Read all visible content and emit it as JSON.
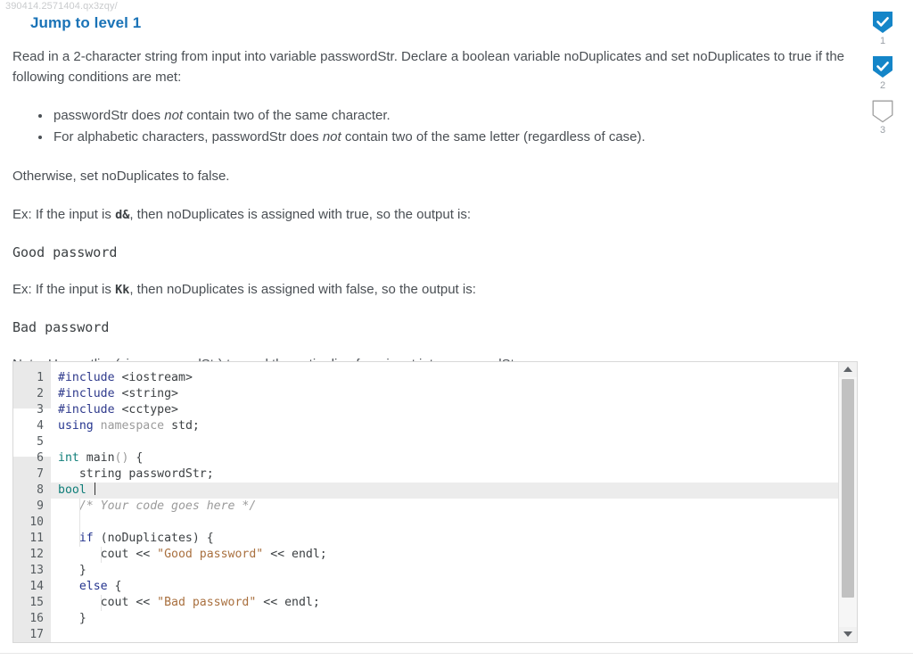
{
  "watermark": "390414.2571404.qx3zqy/",
  "level": {
    "title": "Jump to level 1"
  },
  "prompt": {
    "intro": "Read in a 2-character string from input into variable passwordStr. Declare a boolean variable noDuplicates and set noDuplicates to true if the following conditions are met:",
    "conditions": [
      {
        "pre": "passwordStr does ",
        "em": "not",
        "post": " contain two of the same character."
      },
      {
        "pre": "For alphabetic characters, passwordStr does ",
        "em": "not",
        "post": " contain two of the same letter (regardless of case)."
      }
    ],
    "otherwise": "Otherwise, set noDuplicates to false.",
    "example_true_pre": "Ex: If the input is ",
    "example_true_code": "d&",
    "example_true_post": ", then noDuplicates is assigned with true, so the output is:",
    "output_true": "Good password",
    "example_false_pre": "Ex: If the input is ",
    "example_false_code": "Kk",
    "example_false_post": ", then noDuplicates is assigned with false, so the output is:",
    "output_false": "Bad password",
    "note": "Note: Use getline(cin, passwordStr) to read the entire line from input into passwordStr."
  },
  "progress": {
    "items": [
      {
        "number": "1",
        "state": "complete",
        "icon": "shield-check-icon"
      },
      {
        "number": "2",
        "state": "complete",
        "icon": "shield-check-icon"
      },
      {
        "number": "3",
        "state": "incomplete",
        "icon": "shield-empty-icon"
      }
    ],
    "accent_color": "#1485c8",
    "empty_color": "#ffffff"
  },
  "editor": {
    "language": "cpp",
    "active_line": 8,
    "line_count": 17,
    "lines": [
      {
        "n": "1",
        "tokens": [
          {
            "t": "#include",
            "c": "tk-pre"
          },
          {
            "t": " ",
            "c": "tk-punct"
          },
          {
            "t": "<iostream>",
            "c": "tk-hdr"
          }
        ]
      },
      {
        "n": "2",
        "tokens": [
          {
            "t": "#include",
            "c": "tk-pre"
          },
          {
            "t": " ",
            "c": "tk-punct"
          },
          {
            "t": "<string>",
            "c": "tk-hdr"
          }
        ]
      },
      {
        "n": "3",
        "tokens": [
          {
            "t": "#include",
            "c": "tk-pre"
          },
          {
            "t": " ",
            "c": "tk-punct"
          },
          {
            "t": "<cctype>",
            "c": "tk-hdr"
          }
        ]
      },
      {
        "n": "4",
        "tokens": [
          {
            "t": "using",
            "c": "tk-kw"
          },
          {
            "t": " ",
            "c": "tk-punct"
          },
          {
            "t": "namespace",
            "c": "tk-ns"
          },
          {
            "t": " std;",
            "c": "tk-punct"
          }
        ]
      },
      {
        "n": "5",
        "tokens": []
      },
      {
        "n": "6",
        "tokens": [
          {
            "t": "int",
            "c": "tk-type"
          },
          {
            "t": " main",
            "c": "tk-fn"
          },
          {
            "t": "()",
            "c": "tk-ns"
          },
          {
            "t": " {",
            "c": "tk-punct"
          }
        ]
      },
      {
        "n": "7",
        "tokens": [
          {
            "t": "   string passwordStr;",
            "c": "tk-punct"
          }
        ]
      },
      {
        "n": "8",
        "tokens": [
          {
            "t": "bool",
            "c": "tk-type"
          },
          {
            "t": " ",
            "c": "tk-punct"
          }
        ],
        "caret": true
      },
      {
        "n": "9",
        "tokens": [
          {
            "t": "   /* Your code goes here */",
            "c": "tk-cmt"
          }
        ]
      },
      {
        "n": "10",
        "tokens": []
      },
      {
        "n": "11",
        "tokens": [
          {
            "t": "   ",
            "c": "tk-punct"
          },
          {
            "t": "if",
            "c": "tk-kw"
          },
          {
            "t": " (noDuplicates) {",
            "c": "tk-punct"
          }
        ]
      },
      {
        "n": "12",
        "tokens": [
          {
            "t": "      cout << ",
            "c": "tk-punct"
          },
          {
            "t": "\"Good password\"",
            "c": "tk-str"
          },
          {
            "t": " << endl;",
            "c": "tk-punct"
          }
        ]
      },
      {
        "n": "13",
        "tokens": [
          {
            "t": "   }",
            "c": "tk-punct"
          }
        ]
      },
      {
        "n": "14",
        "tokens": [
          {
            "t": "   ",
            "c": "tk-punct"
          },
          {
            "t": "else",
            "c": "tk-kw"
          },
          {
            "t": " {",
            "c": "tk-punct"
          }
        ]
      },
      {
        "n": "15",
        "tokens": [
          {
            "t": "      cout << ",
            "c": "tk-punct"
          },
          {
            "t": "\"Bad password\"",
            "c": "tk-str"
          },
          {
            "t": " << endl;",
            "c": "tk-punct"
          }
        ]
      },
      {
        "n": "16",
        "tokens": [
          {
            "t": "   }",
            "c": "tk-punct"
          }
        ]
      },
      {
        "n": "17",
        "tokens": []
      }
    ],
    "scrollbar": {
      "up_arrow": "scroll-up-arrow",
      "down_arrow": "scroll-down-arrow"
    }
  }
}
